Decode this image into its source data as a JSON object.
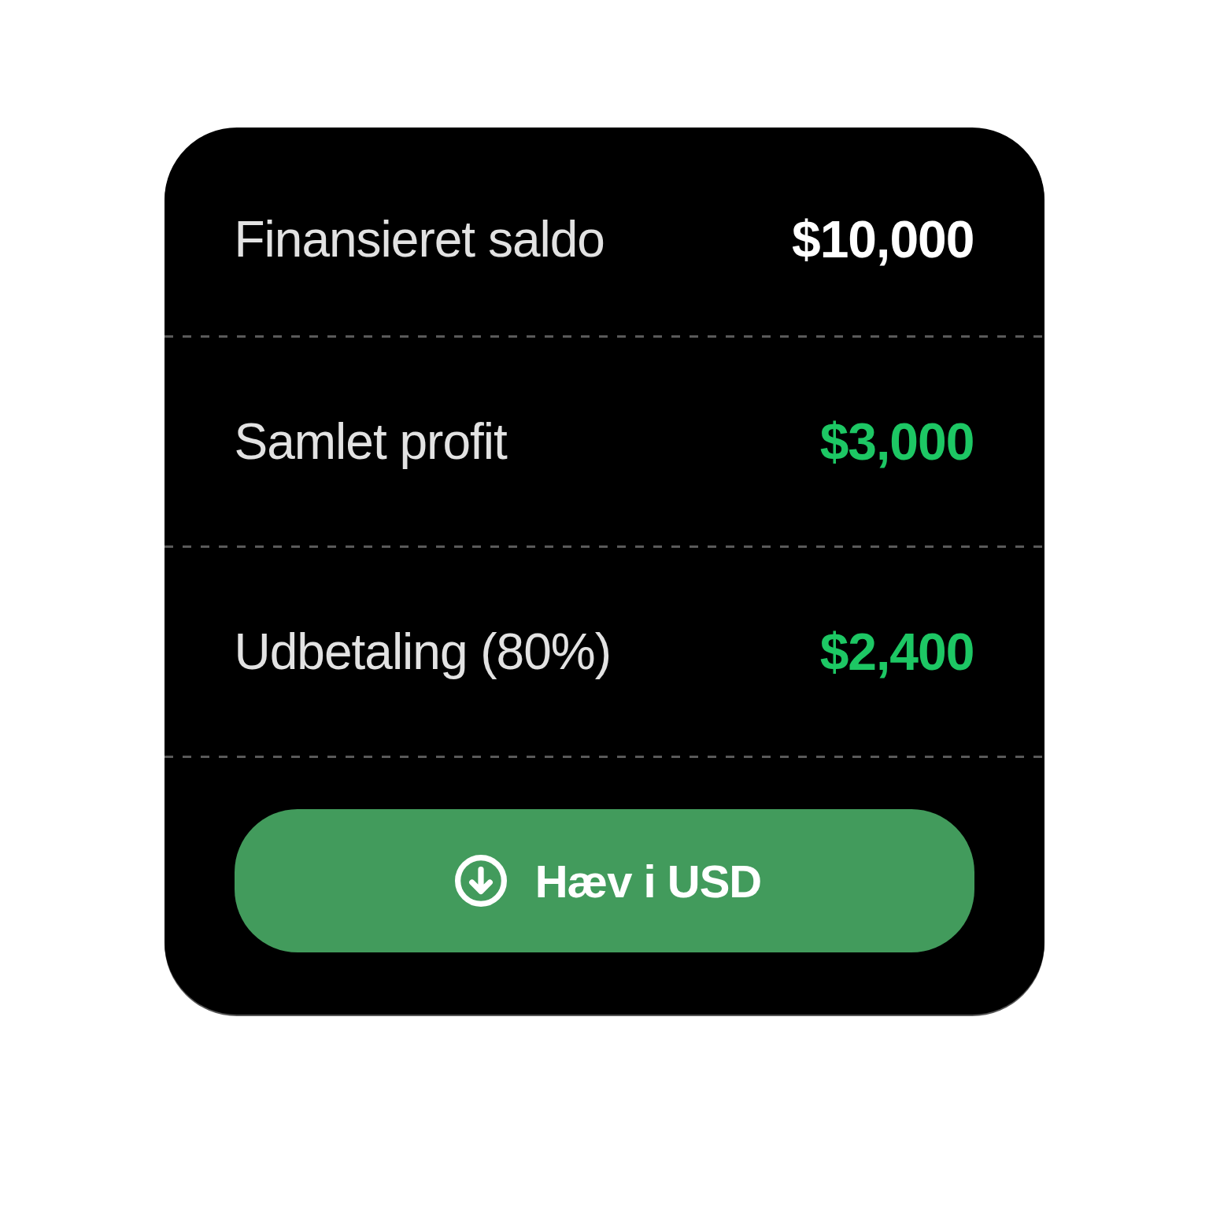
{
  "rows": [
    {
      "label": "Finansieret saldo",
      "value": "$10,000",
      "color": "#ffffff"
    },
    {
      "label": "Samlet profit",
      "value": "$3,000",
      "color": "#1dc764"
    },
    {
      "label": "Udbetaling (80%)",
      "value": "$2,400",
      "color": "#1dc764"
    }
  ],
  "button": {
    "label": "Hæv i USD"
  }
}
